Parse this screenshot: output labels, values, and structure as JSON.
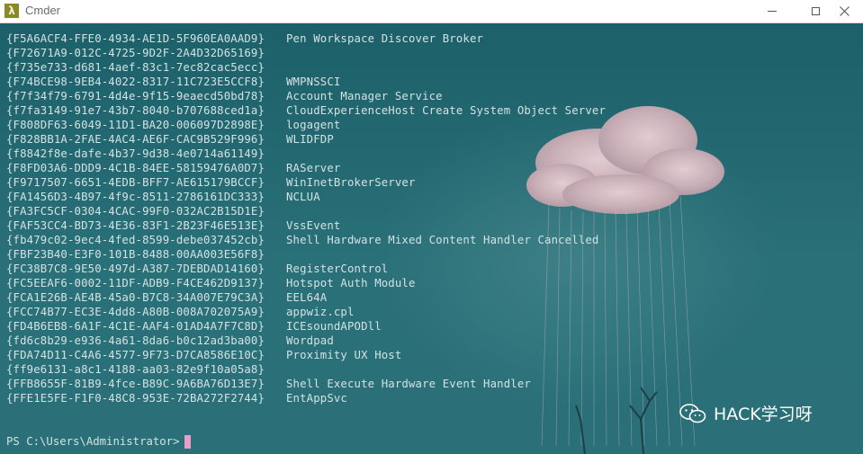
{
  "window": {
    "title": "Cmder",
    "icon": "lambda-icon",
    "icon_glyph": "λ"
  },
  "console": {
    "rows": [
      {
        "guid": "{F5A6ACF4-FFE0-4934-AE1D-5F960EA0AAD9}",
        "name": "Pen Workspace Discover Broker"
      },
      {
        "guid": "{F72671A9-012C-4725-9D2F-2A4D32D65169}",
        "name": ""
      },
      {
        "guid": "{f735e733-d681-4aef-83c1-7ec82cac5ecc}",
        "name": ""
      },
      {
        "guid": "{F74BCE98-9EB4-4022-8317-11C723E5CCF8}",
        "name": "WMPNSSCI"
      },
      {
        "guid": "{f7f34f79-6791-4d4e-9f15-9eaecd50bd78}",
        "name": "Account Manager Service"
      },
      {
        "guid": "{f7fa3149-91e7-43b7-8040-b707688ced1a}",
        "name": "CloudExperienceHost Create System Object Server"
      },
      {
        "guid": "{F808DF63-6049-11D1-BA20-006097D2898E}",
        "name": "logagent"
      },
      {
        "guid": "{F828BB1A-2FAE-4AC4-AE6F-CAC9B529F996}",
        "name": "WLIDFDP"
      },
      {
        "guid": "{f8842f8e-dafe-4b37-9d38-4e0714a61149}",
        "name": ""
      },
      {
        "guid": "{F8FD03A6-DDD9-4C1B-84EE-58159476A0D7}",
        "name": "RAServer"
      },
      {
        "guid": "{F9717507-6651-4EDB-BFF7-AE615179BCCF}",
        "name": "WinInetBrokerServer"
      },
      {
        "guid": "{FA1456D3-4B97-4f9c-8511-2786161DC333}",
        "name": "NCLUA"
      },
      {
        "guid": "{FA3FC5CF-0304-4CAC-99F0-032AC2B15D1E}",
        "name": ""
      },
      {
        "guid": "{FAF53CC4-BD73-4E36-83F1-2B23F46E513E}",
        "name": "VssEvent"
      },
      {
        "guid": "{fb479c02-9ec4-4fed-8599-debe037452cb}",
        "name": "Shell Hardware Mixed Content Handler Cancelled"
      },
      {
        "guid": "{FBF23B40-E3F0-101B-8488-00AA003E56F8}",
        "name": ""
      },
      {
        "guid": "{FC38B7C8-9E50-497d-A387-7DEBDAD14160}",
        "name": "RegisterControl"
      },
      {
        "guid": "{FC5EEAF6-0002-11DF-ADB9-F4CE462D9137}",
        "name": "Hotspot Auth Module"
      },
      {
        "guid": "{FCA1E26B-AE4B-45a0-B7C8-34A007E79C3A}",
        "name": "EEL64A"
      },
      {
        "guid": "{FCC74B77-EC3E-4dd8-A80B-008A702075A9}",
        "name": "appwiz.cpl"
      },
      {
        "guid": "{FD4B6EB8-6A1F-4C1E-AAF4-01AD4A7F7C8D}",
        "name": "ICEsoundAPODll"
      },
      {
        "guid": "{fd6c8b29-e936-4a61-8da6-b0c12ad3ba00}",
        "name": "Wordpad"
      },
      {
        "guid": "{FDA74D11-C4A6-4577-9F73-D7CA8586E10C}",
        "name": "Proximity UX Host"
      },
      {
        "guid": "{ff9e6131-a8c1-4188-aa03-82e9f10a05a8}",
        "name": ""
      },
      {
        "guid": "{FFB8655F-81B9-4fce-B89C-9A6BA76D13E7}",
        "name": "Shell Execute Hardware Event Handler"
      },
      {
        "guid": "{FFE1E5FE-F1F0-48C8-953E-72BA272F2744}",
        "name": "EntAppSvc"
      }
    ],
    "prompt": "PS C:\\Users\\Administrator>"
  },
  "watermark": {
    "text": "HACK学习呀",
    "icon": "wechat-icon"
  },
  "colors": {
    "background": "#236770",
    "text": "#d3e2e3",
    "cursor": "#e4a0c8"
  }
}
